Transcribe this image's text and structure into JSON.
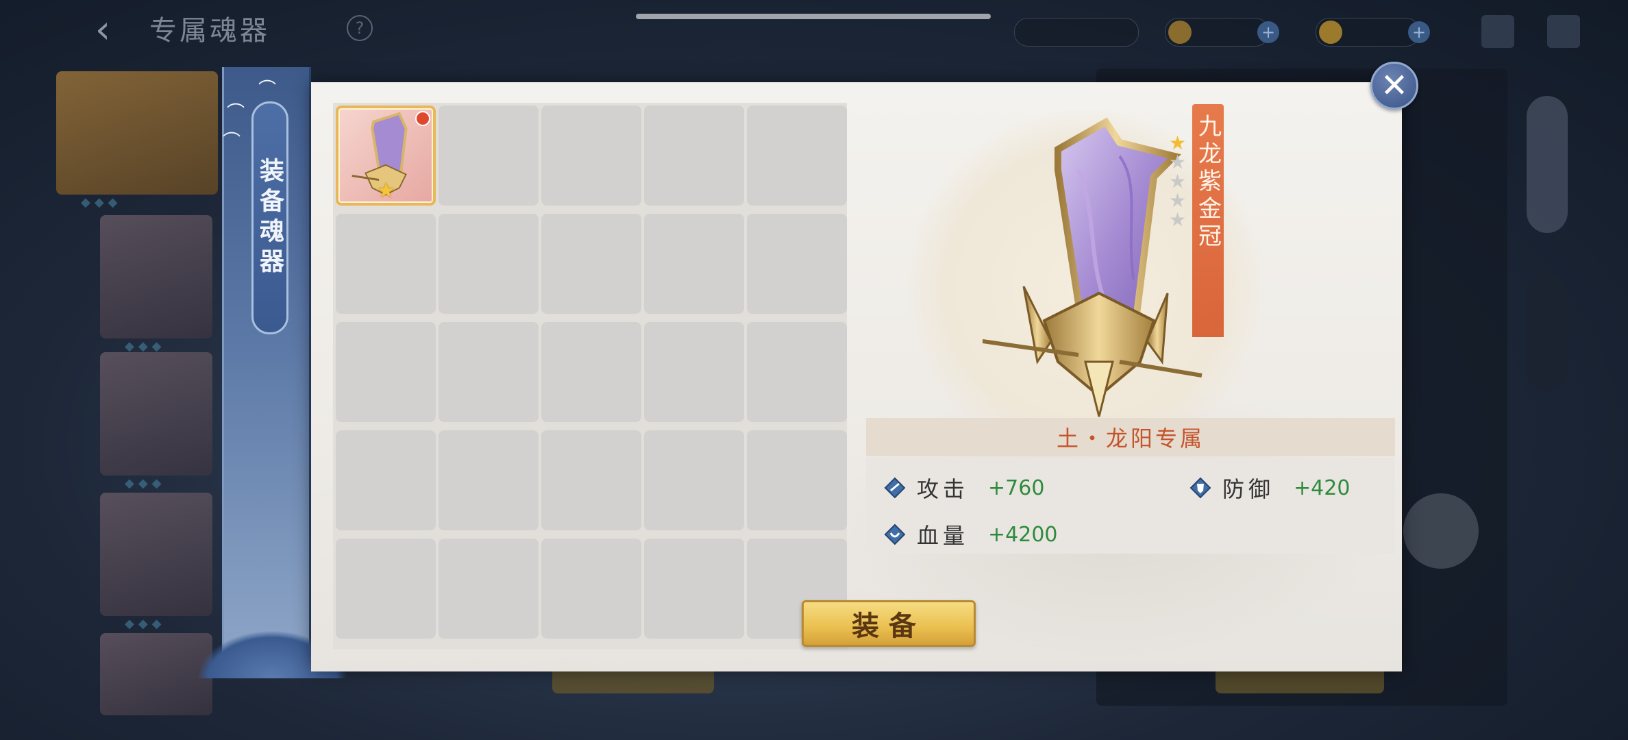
{
  "background": {
    "title": "专属魂器",
    "back_icon": "back-arrow-icon",
    "help_icon": "help-icon",
    "resources": [
      {
        "icon": "gold-coin-icon",
        "value": ""
      },
      {
        "icon": "ingot-icon",
        "value": ""
      }
    ]
  },
  "tab": {
    "label": "装备魂器"
  },
  "inventory": {
    "rows": 5,
    "cols": 5,
    "items": [
      {
        "name": "九龙紫金冠",
        "stars": 1,
        "has_new_badge": true
      }
    ]
  },
  "detail": {
    "item_name": "九龙紫金冠",
    "stars_filled": 1,
    "stars_total": 5,
    "faction": "土・龙阳专属",
    "stats": [
      {
        "label": "攻击",
        "value": "+760",
        "icon": "attack-icon"
      },
      {
        "label": "防御",
        "value": "+420",
        "icon": "defense-icon"
      },
      {
        "label": "血量",
        "value": "+4200",
        "icon": "hp-icon"
      }
    ],
    "equip_label": "装备"
  },
  "colors": {
    "accent_orange": "#d9653b",
    "stat_green": "#2e8b3c",
    "button_gold": "#eabf4f",
    "tab_blue": "#3d5a8a"
  }
}
